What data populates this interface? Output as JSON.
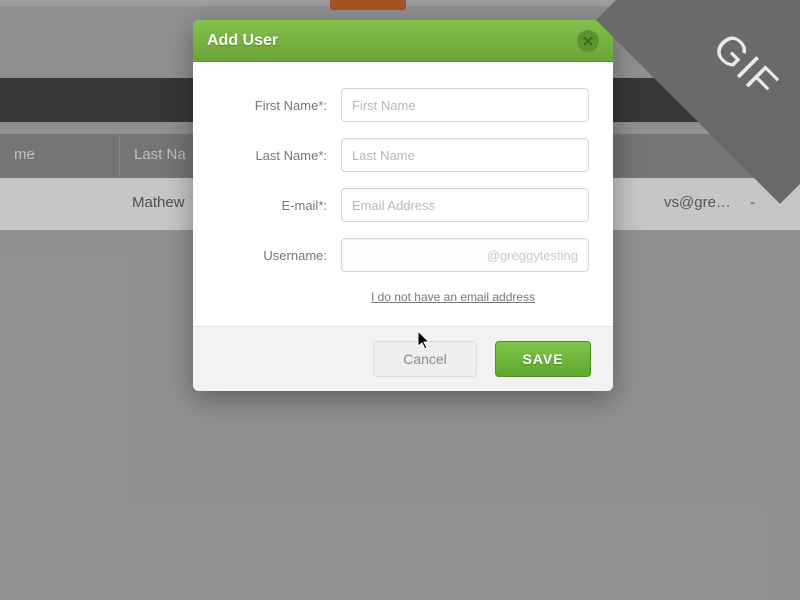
{
  "background": {
    "header_cells": [
      "me",
      "Last Na"
    ],
    "row": {
      "first_name_partial": "Mathew",
      "email_partial": "vs@gre…",
      "dash": "-"
    }
  },
  "modal": {
    "title": "Add User",
    "fields": {
      "first_name": {
        "label": "First Name*:",
        "placeholder": "First Name"
      },
      "last_name": {
        "label": "Last Name*:",
        "placeholder": "Last Name"
      },
      "email": {
        "label": "E-mail*:",
        "placeholder": "Email Address"
      },
      "username": {
        "label": "Username:",
        "suffix": "@greggytesting"
      }
    },
    "no_email_link": "I do not have an email address",
    "buttons": {
      "cancel": "Cancel",
      "save": "SAVE"
    }
  },
  "badge": {
    "gif": "GIF"
  }
}
